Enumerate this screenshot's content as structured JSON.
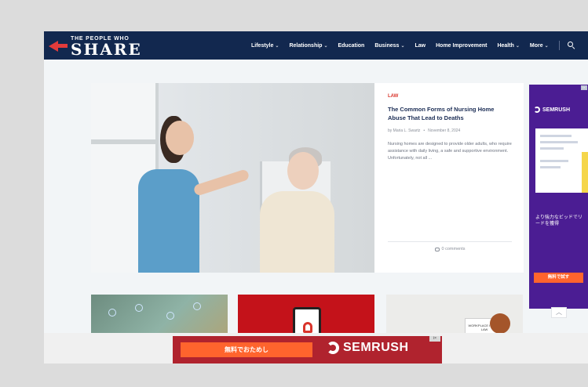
{
  "header": {
    "logo_top": "THE PEOPLE WHO",
    "logo_main": "SHARE",
    "nav": [
      {
        "label": "Lifestyle",
        "dropdown": true
      },
      {
        "label": "Relationship",
        "dropdown": true
      },
      {
        "label": "Education",
        "dropdown": false
      },
      {
        "label": "Business",
        "dropdown": true
      },
      {
        "label": "Law",
        "dropdown": false
      },
      {
        "label": "Home Improvement",
        "dropdown": false
      },
      {
        "label": "Health",
        "dropdown": true
      },
      {
        "label": "More",
        "dropdown": true
      }
    ],
    "search_icon": "search-icon"
  },
  "featured": {
    "category": "LAW",
    "title": "The Common Forms of Nursing Home Abuse That Lead to Deaths",
    "author": "by Maria L. Swartz",
    "separator": "•",
    "date": "November 8, 2024",
    "excerpt": "Nursing homes are designed to provide older adults, who require assistance with daily living, a safe and supportive environment. Unfortunately, not all ...",
    "comments": "0 comments"
  },
  "side_ad": {
    "brand": "SEMRUSH",
    "jp_text": "より強力なビッドでリードを獲得",
    "button": "無料で試す",
    "close": "i×"
  },
  "cards": [
    {
      "name": "card-1"
    },
    {
      "name": "card-2"
    },
    {
      "name": "card-3",
      "book_text": "WORKPLACE INJURY LAW"
    }
  ],
  "scroll_up": "︿",
  "bottom_ad": {
    "button": "無料でおためし",
    "brand": "SEMRUSH",
    "close": "i×"
  },
  "colors": {
    "header_bg": "#12284f",
    "accent_red": "#d9342b",
    "ad_purple": "#4b1d93",
    "ad_orange": "#ff642d",
    "bottom_ad_bg": "#b0232e"
  }
}
